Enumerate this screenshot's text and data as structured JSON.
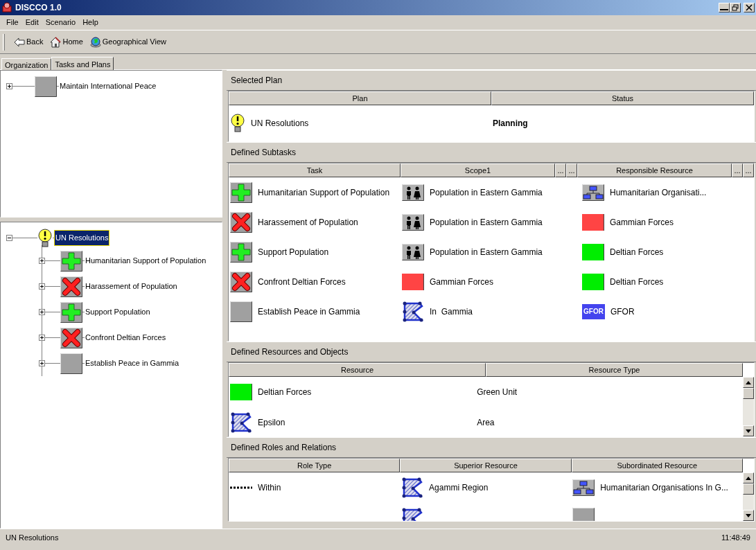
{
  "window": {
    "title": "DISCCO 1.0"
  },
  "menu": [
    "File",
    "Edit",
    "Scenario",
    "Help"
  ],
  "toolbar": [
    {
      "kind": "back",
      "label": "Back"
    },
    {
      "kind": "home",
      "label": "Home"
    },
    {
      "kind": "globe",
      "label": "Geographical View"
    }
  ],
  "tabs": [
    {
      "label": "Organization",
      "selected": false
    },
    {
      "label": "Tasks and Plans",
      "selected": true
    }
  ],
  "task_tree": [
    {
      "kind": "task",
      "label": "Maintain International Peace",
      "expanded": false,
      "selected": false
    }
  ],
  "plan_tree": [
    {
      "kind": "plan",
      "label": "UN Resolutions",
      "expanded": true,
      "selected": true,
      "children": [
        {
          "kind": "support",
          "label": "Humanitarian Support of Population",
          "expanded": false,
          "selected": false
        },
        {
          "kind": "oppose",
          "label": "Harassement of Population",
          "expanded": false,
          "selected": false
        },
        {
          "kind": "support",
          "label": "Support Population",
          "expanded": false,
          "selected": false
        },
        {
          "kind": "oppose",
          "label": "Confront Deltian Forces",
          "expanded": false,
          "selected": false
        },
        {
          "kind": "task",
          "label": "Establish Peace in Gammia",
          "expanded": false,
          "selected": false
        }
      ]
    }
  ],
  "selected_plan": {
    "title": "Selected Plan",
    "columns": [
      {
        "label": "Plan"
      },
      {
        "label": "Status"
      }
    ],
    "rows": [
      [
        {
          "kind": "plan",
          "text": "UN Resolutions"
        },
        {
          "kind": "status",
          "text": "Planning"
        }
      ]
    ]
  },
  "subtasks": {
    "title": "Defined Subtasks",
    "columns": [
      {
        "label": "Task"
      },
      {
        "label": "Scope1",
        "extras": [
          "...",
          "..."
        ]
      },
      {
        "label": "Responsible Resource",
        "extras": [
          "...",
          "..."
        ]
      }
    ],
    "rows": [
      [
        {
          "kind": "support",
          "text": "Humanitarian Support of Population"
        },
        {
          "kind": "people",
          "text": "Population in Eastern Gammia"
        },
        {
          "kind": "org",
          "text": "Humanitarian Organisati..."
        }
      ],
      [
        {
          "kind": "oppose",
          "text": "Harassement of Population"
        },
        {
          "kind": "people",
          "text": "Population in Eastern Gammia"
        },
        {
          "kind": "unit",
          "color": "#ff4444",
          "text": "Gammian Forces"
        }
      ],
      [
        {
          "kind": "support",
          "text": "Support Population"
        },
        {
          "kind": "people",
          "text": "Population in Eastern Gammia"
        },
        {
          "kind": "unit",
          "color": "#00ee00",
          "text": "Deltian Forces"
        }
      ],
      [
        {
          "kind": "oppose",
          "text": "Confront Deltian Forces"
        },
        {
          "kind": "unit",
          "color": "#ff4444",
          "text": "Gammian Forces"
        },
        {
          "kind": "unit",
          "color": "#00ee00",
          "text": "Deltian Forces"
        }
      ],
      [
        {
          "kind": "task",
          "text": "Establish Peace in Gammia"
        },
        {
          "kind": "area",
          "text": "In  Gammia"
        },
        {
          "kind": "badge",
          "badge": "GFOR",
          "text": "GFOR"
        }
      ]
    ]
  },
  "resources": {
    "title": "Defined Resources and Objects",
    "columns": [
      {
        "label": "Resource"
      },
      {
        "label": "Resource Type"
      }
    ],
    "rows": [
      [
        {
          "kind": "unit",
          "color": "#00ee00",
          "text": "Deltian Forces"
        },
        {
          "kind": "plain",
          "text": "Green Unit"
        }
      ],
      [
        {
          "kind": "area",
          "text": "Epsilon"
        },
        {
          "kind": "plain",
          "text": "Area"
        }
      ]
    ]
  },
  "roles": {
    "title": "Defined Roles and Relations",
    "columns": [
      {
        "label": "Role Type"
      },
      {
        "label": "Superior Resource"
      },
      {
        "label": "Subordinated Resource"
      }
    ],
    "rows": [
      [
        {
          "kind": "dotted",
          "text": "Within"
        },
        {
          "kind": "area",
          "text": "Agammi Region"
        },
        {
          "kind": "org",
          "text": "Humanitarian Organisations In G..."
        }
      ],
      [
        {
          "kind": "plain"
        },
        {
          "kind": "area"
        },
        {
          "kind": "task"
        }
      ]
    ]
  },
  "status_bar": {
    "text": "UN Resolutions",
    "time": "11:48:49"
  }
}
